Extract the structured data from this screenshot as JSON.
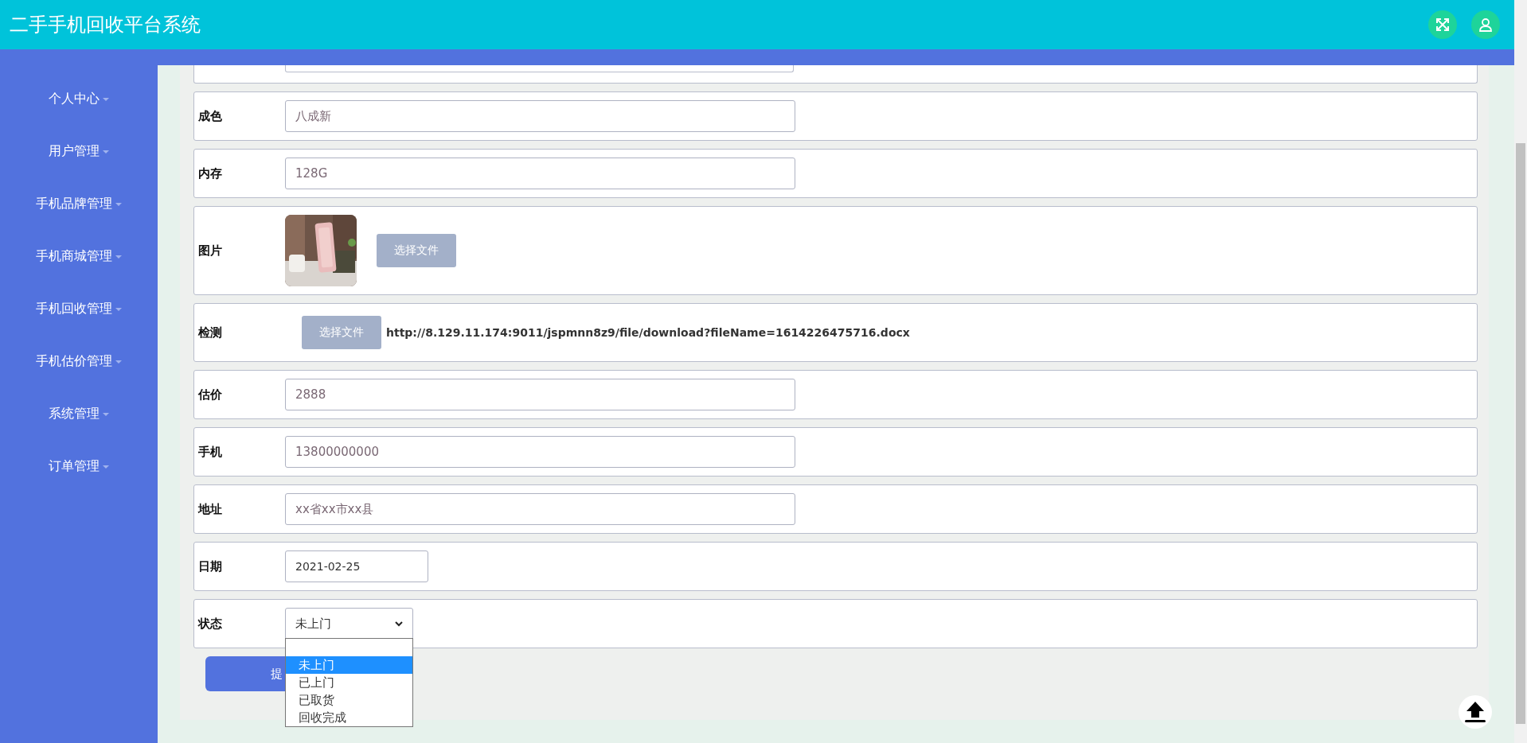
{
  "header": {
    "title": "二手手机回收平台系统"
  },
  "sidebar": {
    "items": [
      {
        "label": "个人中心"
      },
      {
        "label": "用户管理"
      },
      {
        "label": "手机品牌管理"
      },
      {
        "label": "手机商城管理"
      },
      {
        "label": "手机回收管理"
      },
      {
        "label": "手机估价管理"
      },
      {
        "label": "系统管理"
      },
      {
        "label": "订单管理"
      }
    ]
  },
  "form": {
    "fields": [
      {
        "kind": "text",
        "label": "成色",
        "value": "八成新"
      },
      {
        "kind": "text",
        "label": "内存",
        "value": "128G"
      },
      {
        "label": "图片",
        "button": "选择文件"
      },
      {
        "kind": "file",
        "label": "检测",
        "button": "选择文件",
        "link": "http://8.129.11.174:9011/jspmnn8z9/file/download?fileName=1614226475716.docx"
      },
      {
        "kind": "text",
        "label": "估价",
        "value": "2888"
      },
      {
        "kind": "text",
        "label": "手机",
        "value": "13800000000"
      },
      {
        "kind": "text",
        "label": "地址",
        "value": "xx省xx市xx县"
      },
      {
        "kind": "date",
        "label": "日期",
        "value": "2021-02-25"
      },
      {
        "kind": "select",
        "label": "状态",
        "value": "未上门",
        "expanded": true,
        "options": [
          {
            "label": "未上门",
            "selected": true
          },
          {
            "label": "已上门",
            "selected": false
          },
          {
            "label": "已取货",
            "selected": false
          },
          {
            "label": "回收完成",
            "selected": false
          }
        ]
      }
    ],
    "submit": "提"
  }
}
